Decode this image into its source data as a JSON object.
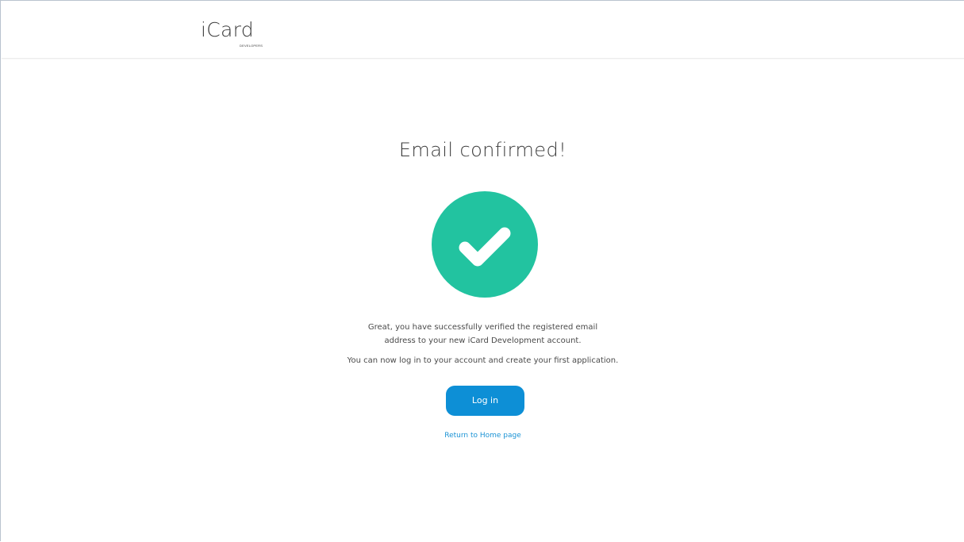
{
  "header": {
    "logo": {
      "name": "iCard",
      "subtitle": "DEVELOPERS"
    }
  },
  "main": {
    "title": "Email confirmed!",
    "status_icon": "check-circle-icon",
    "message_lines": [
      "Great, you have successfully verified the registered email",
      "address to your new iCard Development account.",
      "You can now log in to your account and create your first application."
    ],
    "login_button": "Log in",
    "home_link": "Return to Home page"
  },
  "colors": {
    "success": "#22c3a0",
    "primary_button": "#0d8fd6",
    "link": "#1b93d5",
    "text": "#3c3c3c"
  }
}
